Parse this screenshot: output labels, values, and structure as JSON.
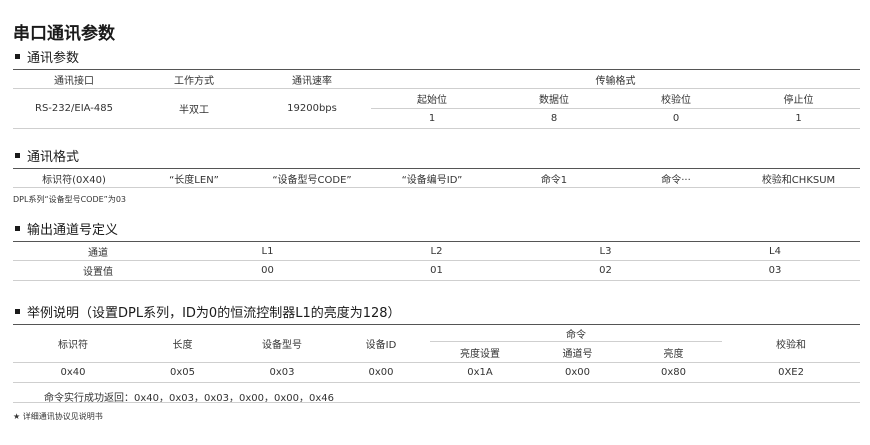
{
  "page_title": "串口通讯参数",
  "sections": {
    "params": "通讯参数",
    "format": "通讯格式",
    "channel": "输出通道号定义",
    "example": "举例说明（设置DPL系列，ID为0的恒流控制器L1的亮度为128）"
  },
  "params_table": {
    "headers": [
      "通讯接口",
      "工作方式",
      "通讯速率",
      "传输格式"
    ],
    "sub_headers": [
      "起始位",
      "数据位",
      "校验位",
      "停止位"
    ],
    "interface": "RS-232/EIA-485",
    "mode": "半双工",
    "rate": "19200bps",
    "sub_values": [
      "1",
      "8",
      "0",
      "1"
    ]
  },
  "format_table": {
    "cells": [
      "标识符(0X40)",
      "“长度LEN”",
      "“设备型号CODE”",
      "“设备编号ID”",
      "命令1",
      "命令···",
      "校验和CHKSUM"
    ]
  },
  "format_note": "DPL系列“设备型号CODE”为03",
  "channel_table": {
    "header": [
      "通道",
      "L1",
      "L2",
      "L3",
      "L4"
    ],
    "values": [
      "设置值",
      "00",
      "01",
      "02",
      "03"
    ]
  },
  "example_table": {
    "headers": [
      "标识符",
      "长度",
      "设备型号",
      "设备ID",
      "命令",
      "校验和"
    ],
    "command_sub": [
      "亮度设置",
      "通道号",
      "亮度"
    ],
    "values": [
      "0x40",
      "0x05",
      "0x03",
      "0x00",
      "0x1A",
      "0x00",
      "0x80",
      "0XE2"
    ],
    "ack": "命令实行成功返回：0x40，0x03，0x03，0x00，0x00，0x46"
  },
  "footnote": "★ 详细通讯协议见说明书"
}
